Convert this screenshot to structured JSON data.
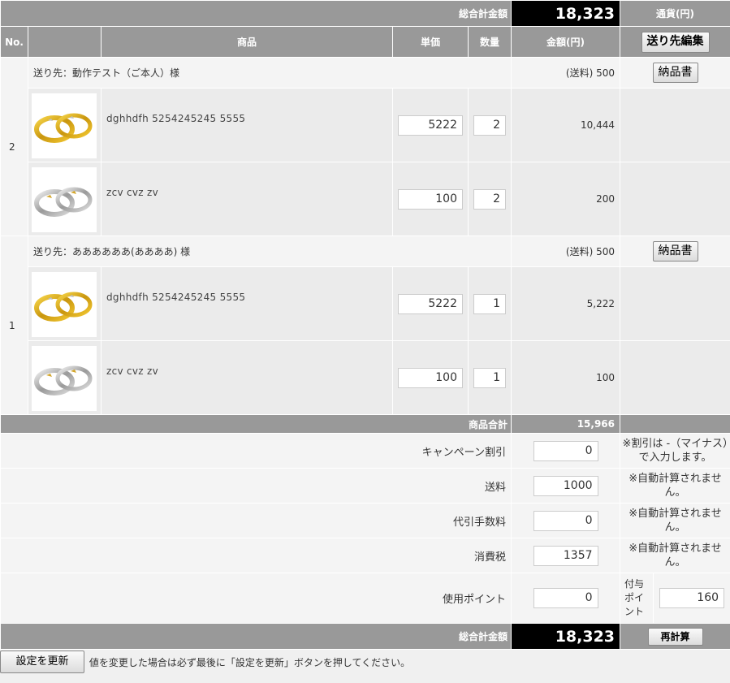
{
  "header": {
    "grand_total_label": "総合計金額",
    "grand_total_value": "18,323",
    "currency_label": "通貨(円)"
  },
  "columns": {
    "no": "No.",
    "product": "商品",
    "unit_price": "単価",
    "quantity": "数量",
    "amount": "金額(円)",
    "edit_dest_button": "送り先編集"
  },
  "groups": [
    {
      "no": "2",
      "destination": "送り先：動作テスト（ご本人）様",
      "shipping_label": "(送料) 500",
      "delivery_note_button": "納品書",
      "items": [
        {
          "name": "dghhdfh 5254245245 5555",
          "image": "gold-ring",
          "unit_price": "5222",
          "quantity": "2",
          "amount": "10,444"
        },
        {
          "name": "zcv cvz zv",
          "image": "silver-ring",
          "unit_price": "100",
          "quantity": "2",
          "amount": "200"
        }
      ]
    },
    {
      "no": "1",
      "destination": "送り先：ああああああ(ああああ) 様",
      "shipping_label": "(送料) 500",
      "delivery_note_button": "納品書",
      "items": [
        {
          "name": "dghhdfh 5254245245 5555",
          "image": "gold-ring",
          "unit_price": "5222",
          "quantity": "1",
          "amount": "5,222"
        },
        {
          "name": "zcv cvz zv",
          "image": "silver-ring",
          "unit_price": "100",
          "quantity": "1",
          "amount": "100"
        }
      ]
    }
  ],
  "summary": {
    "subtotal_label": "商品合計",
    "subtotal_value": "15,966",
    "campaign_label": "キャンペーン割引",
    "campaign_value": "0",
    "campaign_note": "※割引は -（マイナス）で入力します。",
    "shipping_label": "送料",
    "shipping_value": "1000",
    "shipping_note": "※自動計算されません。",
    "cod_label": "代引手数料",
    "cod_value": "0",
    "cod_note": "※自動計算されません。",
    "tax_label": "消費税",
    "tax_value": "1357",
    "tax_note": "※自動計算されません。",
    "points_label": "使用ポイント",
    "points_value": "0",
    "grant_points_label": "付与ポイント",
    "grant_points_value": "160",
    "grand_total_label": "総合計金額",
    "grand_total_value": "18,323",
    "recalc_button": "再計算"
  },
  "footer": {
    "update_button": "設定を更新",
    "message": "値を変更した場合は必ず最後に「設定を更新」ボタンを押してください。"
  },
  "colors": {
    "header_bg": "#999999",
    "total_bg": "#000000",
    "row_bg": "#f4f4f4"
  }
}
